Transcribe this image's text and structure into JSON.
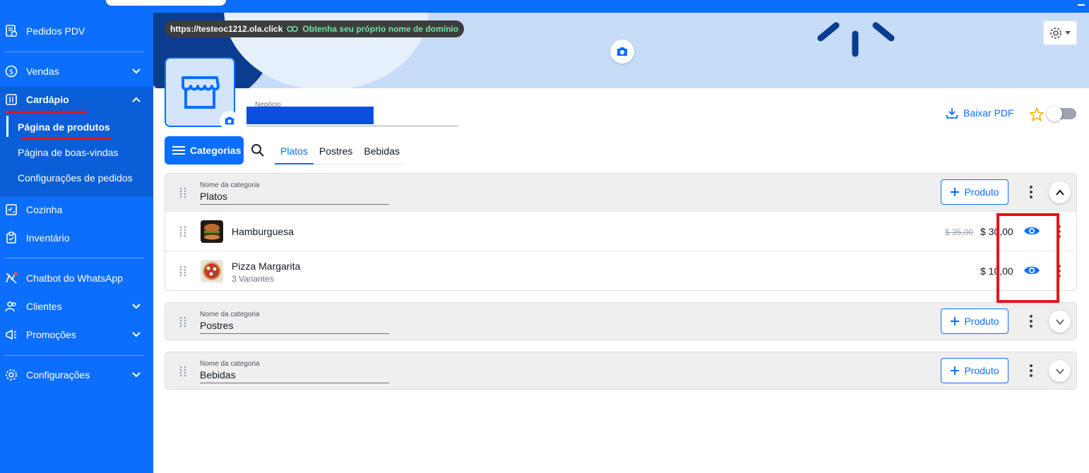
{
  "topbar": {
    "brand": "Ola.click"
  },
  "sidebar": {
    "items": [
      {
        "label": "Pedidos PDV",
        "icon": "receipt-icon"
      },
      {
        "label": "Vendas",
        "icon": "dollar-circle-icon"
      },
      {
        "label": "Cardápio",
        "icon": "menu-book-icon"
      },
      {
        "label": "Cozinha",
        "icon": "kitchen-checklist-icon"
      },
      {
        "label": "Inventário",
        "icon": "clipboard-icon"
      },
      {
        "label": "Chatbot do WhatsApp",
        "icon": "chatbot-icon"
      },
      {
        "label": "Clientes",
        "icon": "users-icon"
      },
      {
        "label": "Promoções",
        "icon": "megaphone-icon"
      },
      {
        "label": "Configurações",
        "icon": "gear-icon"
      }
    ],
    "cardapio_sub": [
      {
        "label": "Página de produtos"
      },
      {
        "label": "Página de boas-vindas"
      },
      {
        "label": "Configurações de pedidos"
      }
    ]
  },
  "header": {
    "url": "https://testeoc1212.ola.click",
    "domain_link": "Obtenha seu próprio nome de domínio",
    "negocio_label": "Negócio",
    "baixar_pdf": "Baixar PDF"
  },
  "toolbar": {
    "categorias_label": "Categorias",
    "tabs": [
      "Platos",
      "Postres",
      "Bebidas"
    ]
  },
  "categories": [
    {
      "field_label": "Nome da categoria",
      "name": "Platos",
      "add_label": "Produto",
      "products": [
        {
          "name": "Hamburguesa",
          "old_price": "$ 35,00",
          "price": "$ 30,00",
          "sub": ""
        },
        {
          "name": "Pizza Margarita",
          "old_price": "",
          "price": "$ 10,00",
          "sub": "3 Variantes"
        }
      ]
    },
    {
      "field_label": "Nome da categoria",
      "name": "Postres",
      "add_label": "Produto"
    },
    {
      "field_label": "Nome da categoria",
      "name": "Bebidas",
      "add_label": "Produto"
    }
  ],
  "colors": {
    "primary": "#0b6efd",
    "annotation_red": "#e5141b",
    "domain_green": "#6fe3a6"
  }
}
